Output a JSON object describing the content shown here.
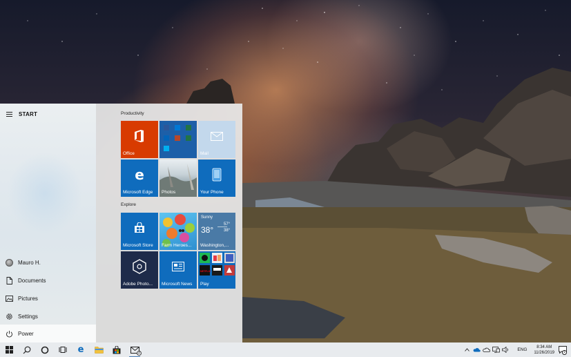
{
  "start_menu": {
    "title": "START",
    "rail_items": [
      {
        "label": "Mauro H.",
        "icon": "user-avatar"
      },
      {
        "label": "Documents",
        "icon": "document-icon"
      },
      {
        "label": "Pictures",
        "icon": "pictures-icon"
      },
      {
        "label": "Settings",
        "icon": "gear-icon"
      },
      {
        "label": "Power",
        "icon": "power-icon"
      }
    ],
    "groups": [
      {
        "title": "Productivity",
        "tiles": [
          {
            "label": "Office",
            "color": "#d83b01"
          },
          {
            "label": "",
            "color": "#1d5fa8"
          },
          {
            "label": "Mail",
            "color": "#c3d8ec"
          },
          {
            "label": "Microsoft Edge",
            "color": "#0f6cbd"
          },
          {
            "label": "Photos",
            "color": "#b6c8d4"
          },
          {
            "label": "Your Phone",
            "color": "#0f6cbd"
          }
        ]
      },
      {
        "title": "Explore",
        "tiles": [
          {
            "label": "Microsoft Store",
            "color": "#0f6cbd"
          },
          {
            "label": "Farm Heroes...",
            "color": "#4fa6d8"
          },
          {
            "label": "Washington,...",
            "color": "#4a7aa6",
            "condition": "Sunny",
            "temp": "38°",
            "high": "57°",
            "low": "38°"
          },
          {
            "label": "Adobe Photo...",
            "color": "#1e2b4a"
          },
          {
            "label": "Microsoft News",
            "color": "#0f6cbd"
          },
          {
            "label": "Play",
            "color": "#0f6cbd",
            "netflix": "NETFLIX"
          }
        ]
      }
    ]
  },
  "taskbar": {
    "pinned": [
      "windows-logo-icon",
      "search-icon",
      "cortana-icon",
      "task-view-icon",
      "edge-icon",
      "file-explorer-icon",
      "store-icon",
      "mail-icon"
    ],
    "mail_badge": "2",
    "tray": {
      "language": "ENG",
      "time": "8:34 AM",
      "date": "11/26/2019",
      "notification_count": "1"
    }
  }
}
